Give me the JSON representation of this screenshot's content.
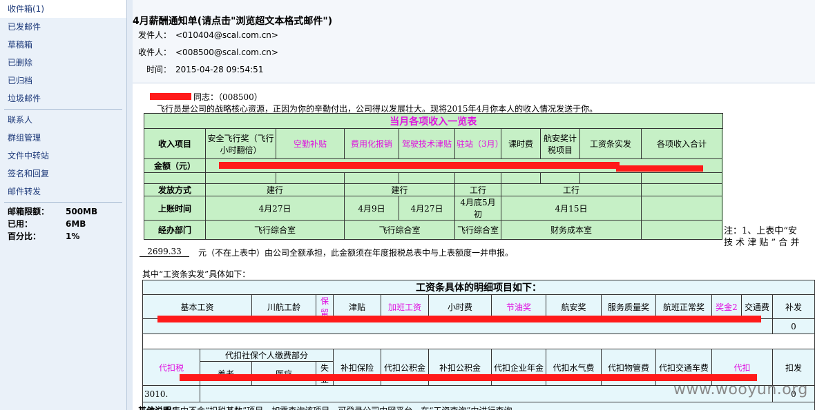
{
  "sidebar": {
    "folders": [
      "收件箱(1)",
      "已发邮件",
      "草稿箱",
      "已删除",
      "已归档",
      "垃圾邮件"
    ],
    "tools": [
      "联系人",
      "群组管理",
      "文件中转站",
      "签名和回复",
      "邮件转发"
    ],
    "quota": [
      {
        "k": "邮箱限额：",
        "v": "500MB"
      },
      {
        "k": "已用：",
        "v": "6MB"
      },
      {
        "k": "百分比：",
        "v": "1%"
      }
    ]
  },
  "mail": {
    "subject": "4月薪酬通知单(请点击\"浏览超文本格式邮件\")",
    "from_label": "发件人：",
    "from": "<010404@scal.com.cn>",
    "to_label": "收件人：",
    "to": "<008500@scal.com.cn>",
    "time_label": "时间：",
    "time": "2015-04-28 09:54:51"
  },
  "body": {
    "greeting": "同志：（008500）",
    "intro": "飞行员是公司的战略核心资源，正因为你的辛勤付出，公司得以发展壮大。现将2015年4月你本人的收入情况发送于你。",
    "note_right_1": "注：1、上表中“安",
    "note_right_2": "技 术 津 贴 ” 合 并",
    "amount_line_value": "2699.33",
    "amount_line_text": "元（不在上表中）由公司全额承担，此金额须在年度报税总表中与上表额度一并申报。",
    "detail_intro": "其中“工资条实发”具体如下：",
    "partial_next": "其他说明："
  },
  "income_table": {
    "title": "当月各项收入一览表",
    "row_header": "收入项目",
    "headers": [
      "安全飞行奖（飞行小时翻倍）",
      "空勤补贴",
      "费用化报销",
      "驾驶技术津贴",
      "驻站（3月）",
      "课时费",
      "航安奖计税项目",
      "工资条实发",
      "各项收入合计"
    ],
    "amount_label": "金额（元）",
    "pay_method_label": "发放方式",
    "pay_methods": [
      "建行",
      "建行",
      "工行",
      "工行"
    ],
    "date_label": "上账时间",
    "dates": [
      "4月27日",
      "4月9日",
      "4月27日",
      "4月底5月初",
      "4月15日"
    ],
    "dept_label": "经办部门",
    "depts": [
      "飞行综合室",
      "飞行综合室",
      "飞行综合室",
      "财务成本室"
    ]
  },
  "detail_table": {
    "title": "工资条具体的明细项目如下：",
    "headers": [
      "基本工资",
      "川航工龄",
      "保留",
      "津贴",
      "加班工资",
      "小时费",
      "节油奖",
      "航安奖",
      "服务质量奖",
      "航班正常奖",
      "奖金2",
      "交通费",
      "补发"
    ],
    "bufa_value": "0",
    "deduct_headers": [
      "代扣税",
      "代扣社保个人缴费部分",
      "补扣保险",
      "代扣公积金",
      "补扣公积金",
      "代扣企业年金",
      "代扣水气费",
      "代扣物管费",
      "代扣交通车费",
      "代扣",
      "扣发"
    ],
    "social_sub": [
      "养老",
      "医疗",
      "失业"
    ],
    "tax_value": "3010.",
    "kofa_value": "0",
    "footnote": "注：此表中不含“扣税基数”项目，如需查询该项目，可登录公司内网平台，在“工资查询”中进行查询。"
  },
  "watermark": "www.wooyun.org"
}
